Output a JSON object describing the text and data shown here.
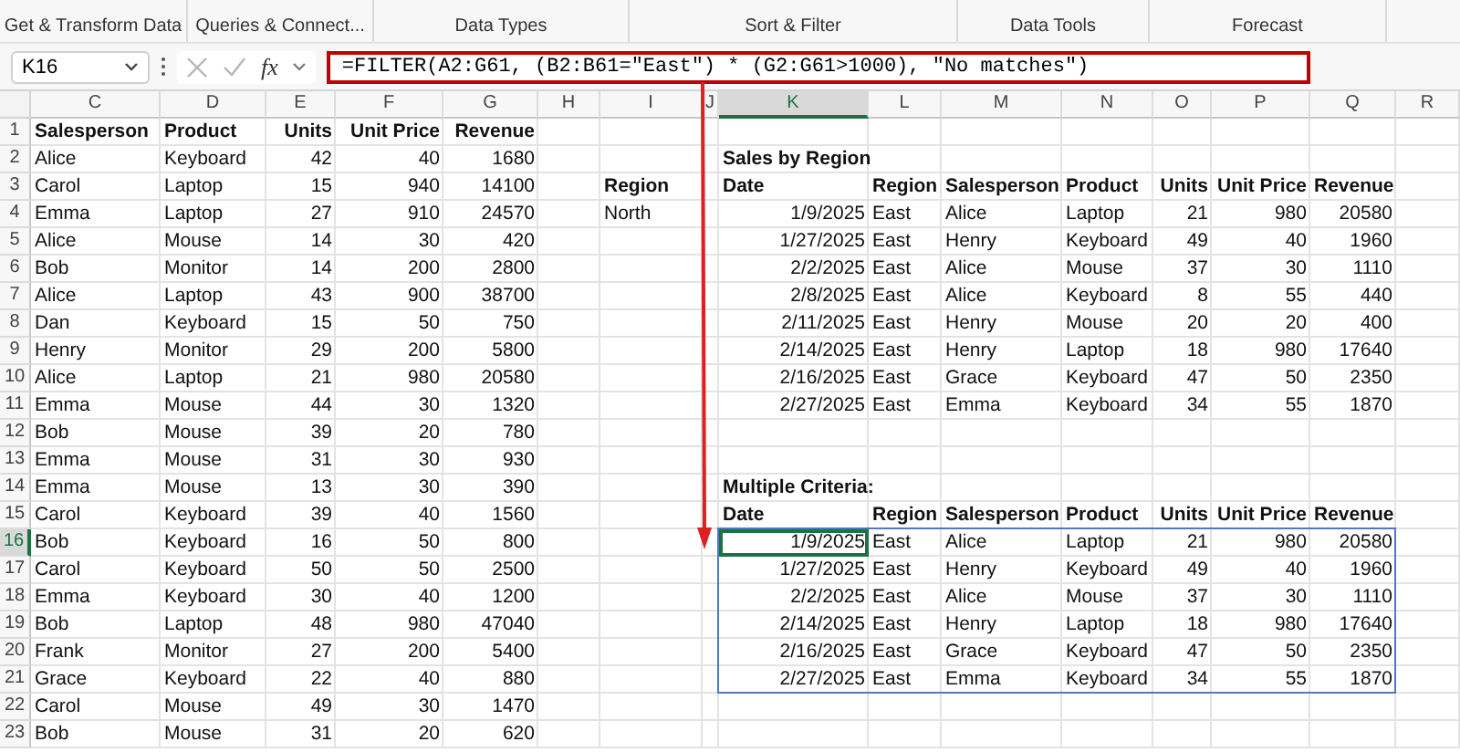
{
  "ribbon_groups": [
    "Get & Transform Data",
    "Queries & Connect...",
    "Data Types",
    "Sort & Filter",
    "Data Tools",
    "Forecast"
  ],
  "name_box": "K16",
  "function_label": "fx",
  "formula": "=FILTER(A2:G61, (B2:B61=\"East\") * (G2:G61>1000), \"No matches\")",
  "columns": [
    {
      "label": "C",
      "selected": false
    },
    {
      "label": "D",
      "selected": false
    },
    {
      "label": "E",
      "selected": false
    },
    {
      "label": "F",
      "selected": false
    },
    {
      "label": "G",
      "selected": false
    },
    {
      "label": "H",
      "selected": false
    },
    {
      "label": "I",
      "selected": false
    },
    {
      "label": "J",
      "selected": false
    },
    {
      "label": "K",
      "selected": true
    },
    {
      "label": "L",
      "selected": false
    },
    {
      "label": "M",
      "selected": false
    },
    {
      "label": "N",
      "selected": false
    },
    {
      "label": "O",
      "selected": false
    },
    {
      "label": "P",
      "selected": false
    },
    {
      "label": "Q",
      "selected": false
    },
    {
      "label": "R",
      "selected": false
    }
  ],
  "rows": [
    {
      "label": "1",
      "selected": false
    },
    {
      "label": "2",
      "selected": false
    },
    {
      "label": "3",
      "selected": false
    },
    {
      "label": "4",
      "selected": false
    },
    {
      "label": "5",
      "selected": false
    },
    {
      "label": "6",
      "selected": false
    },
    {
      "label": "7",
      "selected": false
    },
    {
      "label": "8",
      "selected": false
    },
    {
      "label": "9",
      "selected": false
    },
    {
      "label": "10",
      "selected": false
    },
    {
      "label": "11",
      "selected": false
    },
    {
      "label": "12",
      "selected": false
    },
    {
      "label": "13",
      "selected": false
    },
    {
      "label": "14",
      "selected": false
    },
    {
      "label": "15",
      "selected": false
    },
    {
      "label": "16",
      "selected": true
    },
    {
      "label": "17",
      "selected": false
    },
    {
      "label": "18",
      "selected": false
    },
    {
      "label": "19",
      "selected": false
    },
    {
      "label": "20",
      "selected": false
    },
    {
      "label": "21",
      "selected": false
    },
    {
      "label": "22",
      "selected": false
    },
    {
      "label": "23",
      "selected": false
    }
  ],
  "source_table": {
    "header": [
      "Salesperson",
      "Product",
      "Units",
      "Unit Price",
      "Revenue"
    ],
    "rows": [
      [
        "Alice",
        "Keyboard",
        "42",
        "40",
        "1680"
      ],
      [
        "Carol",
        "Laptop",
        "15",
        "940",
        "14100"
      ],
      [
        "Emma",
        "Laptop",
        "27",
        "910",
        "24570"
      ],
      [
        "Alice",
        "Mouse",
        "14",
        "30",
        "420"
      ],
      [
        "Bob",
        "Monitor",
        "14",
        "200",
        "2800"
      ],
      [
        "Alice",
        "Laptop",
        "43",
        "900",
        "38700"
      ],
      [
        "Dan",
        "Keyboard",
        "15",
        "50",
        "750"
      ],
      [
        "Henry",
        "Monitor",
        "29",
        "200",
        "5800"
      ],
      [
        "Alice",
        "Laptop",
        "21",
        "980",
        "20580"
      ],
      [
        "Emma",
        "Mouse",
        "44",
        "30",
        "1320"
      ],
      [
        "Bob",
        "Mouse",
        "39",
        "20",
        "780"
      ],
      [
        "Emma",
        "Mouse",
        "31",
        "30",
        "930"
      ],
      [
        "Emma",
        "Mouse",
        "13",
        "30",
        "390"
      ],
      [
        "Carol",
        "Keyboard",
        "39",
        "40",
        "1560"
      ],
      [
        "Bob",
        "Keyboard",
        "16",
        "50",
        "800"
      ],
      [
        "Carol",
        "Keyboard",
        "50",
        "50",
        "2500"
      ],
      [
        "Emma",
        "Keyboard",
        "30",
        "40",
        "1200"
      ],
      [
        "Bob",
        "Laptop",
        "48",
        "980",
        "47040"
      ],
      [
        "Frank",
        "Monitor",
        "27",
        "200",
        "5400"
      ],
      [
        "Grace",
        "Keyboard",
        "22",
        "40",
        "880"
      ],
      [
        "Carol",
        "Mouse",
        "49",
        "30",
        "1470"
      ],
      [
        "Bob",
        "Mouse",
        "31",
        "20",
        "620"
      ]
    ]
  },
  "criteria": {
    "label": "Region",
    "value": "North"
  },
  "sales_by_region": {
    "title": "Sales by Region",
    "header": [
      "Date",
      "Region",
      "Salesperson",
      "Product",
      "Units",
      "Unit Price",
      "Revenue"
    ],
    "rows": [
      [
        "1/9/2025",
        "East",
        "Alice",
        "Laptop",
        "21",
        "980",
        "20580"
      ],
      [
        "1/27/2025",
        "East",
        "Henry",
        "Keyboard",
        "49",
        "40",
        "1960"
      ],
      [
        "2/2/2025",
        "East",
        "Alice",
        "Mouse",
        "37",
        "30",
        "1110"
      ],
      [
        "2/8/2025",
        "East",
        "Alice",
        "Keyboard",
        "8",
        "55",
        "440"
      ],
      [
        "2/11/2025",
        "East",
        "Henry",
        "Mouse",
        "20",
        "20",
        "400"
      ],
      [
        "2/14/2025",
        "East",
        "Henry",
        "Laptop",
        "18",
        "980",
        "17640"
      ],
      [
        "2/16/2025",
        "East",
        "Grace",
        "Keyboard",
        "47",
        "50",
        "2350"
      ],
      [
        "2/27/2025",
        "East",
        "Emma",
        "Keyboard",
        "34",
        "55",
        "1870"
      ]
    ]
  },
  "multiple_criteria": {
    "title": "Multiple Criteria:",
    "spill_outline": true,
    "header": [
      "Date",
      "Region",
      "Salesperson",
      "Product",
      "Units",
      "Unit Price",
      "Revenue"
    ],
    "rows": [
      [
        "1/9/2025",
        "East",
        "Alice",
        "Laptop",
        "21",
        "980",
        "20580"
      ],
      [
        "1/27/2025",
        "East",
        "Henry",
        "Keyboard",
        "49",
        "40",
        "1960"
      ],
      [
        "2/2/2025",
        "East",
        "Alice",
        "Mouse",
        "37",
        "30",
        "1110"
      ],
      [
        "2/14/2025",
        "East",
        "Henry",
        "Laptop",
        "18",
        "980",
        "17640"
      ],
      [
        "2/16/2025",
        "East",
        "Grace",
        "Keyboard",
        "47",
        "50",
        "2350"
      ],
      [
        "2/27/2025",
        "East",
        "Emma",
        "Keyboard",
        "34",
        "55",
        "1870"
      ]
    ]
  }
}
